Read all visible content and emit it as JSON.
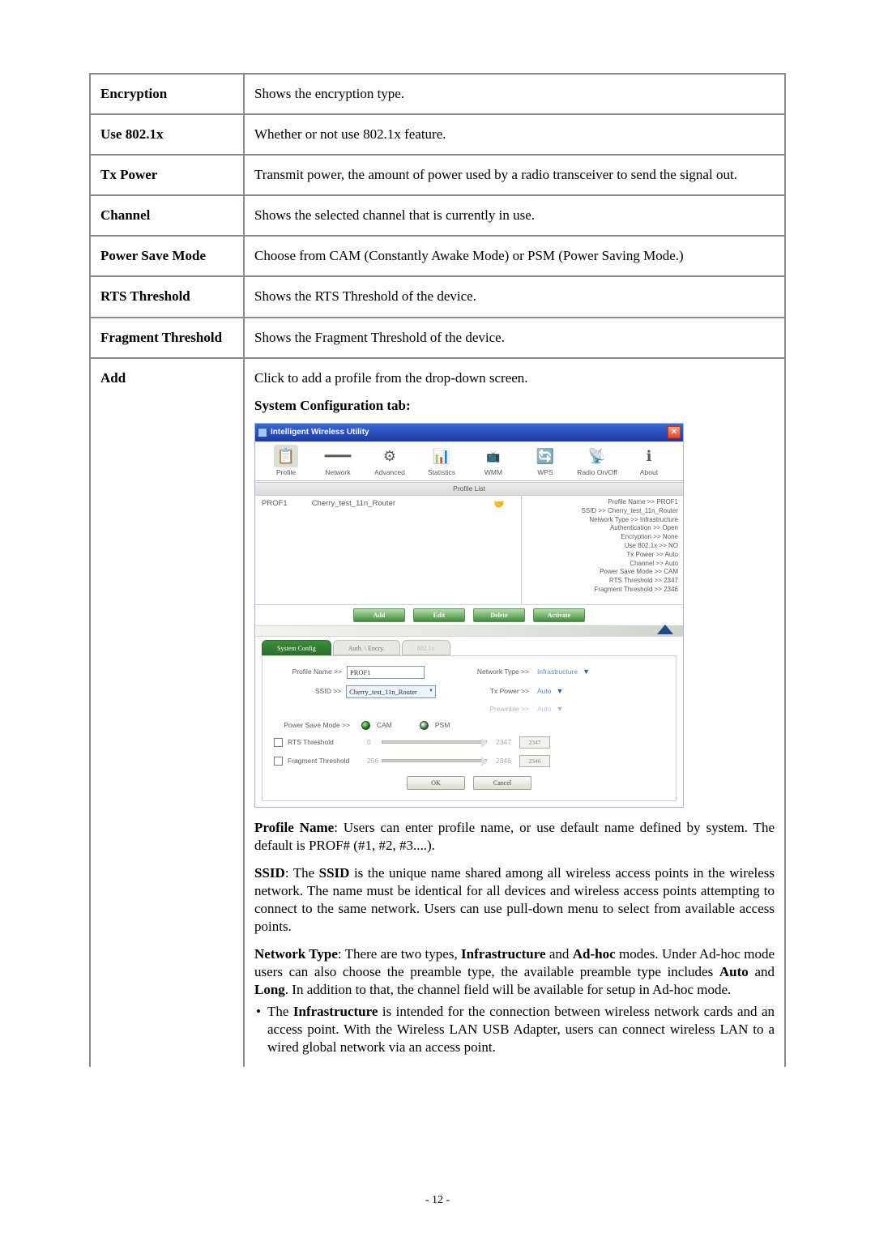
{
  "rows": [
    {
      "label": "Encryption",
      "desc": "Shows the encryption type."
    },
    {
      "label": "Use 802.1x",
      "desc": "Whether or not use 802.1x feature."
    },
    {
      "label": "Tx Power",
      "desc": "Transmit power, the amount of power used by a radio transceiver to send the signal out."
    },
    {
      "label": "Channel",
      "desc": "Shows the selected channel that is currently in use."
    },
    {
      "label": "Power Save Mode",
      "desc": "Choose from CAM (Constantly Awake Mode) or PSM (Power Saving Mode.)"
    },
    {
      "label": "RTS Threshold",
      "desc": "Shows the RTS Threshold of the device."
    },
    {
      "label": "Fragment Threshold",
      "desc": "Shows the Fragment Threshold of the device."
    }
  ],
  "add": {
    "label": "Add",
    "intro": "Click to add a profile from the drop-down screen.",
    "tab_heading": "System Configuration tab:",
    "profile_name_lead": "Profile Name",
    "profile_name_text": ": Users can enter profile name, or use default name defined by system. The default is PROF# (#1, #2, #3....).",
    "ssid_lead1": "SSID",
    "ssid_text1": ": The ",
    "ssid_lead2": "SSID",
    "ssid_text2": " is the unique name shared among all wireless access points in the wireless network. The name must be identical for all devices and wireless access points attempting to connect to the same network. Users can use pull-down menu to select from available access points.",
    "nt_lead": "Network Type",
    "nt_text1": ": There are two types, ",
    "nt_b1": "Infrastructure",
    "nt_text2": " and ",
    "nt_b2": "Ad-hoc",
    "nt_text3": " modes. Under Ad-hoc mode users can also choose the preamble type, the available preamble type includes ",
    "nt_b3": "Auto",
    "nt_text4": " and ",
    "nt_b4": "Long",
    "nt_text5": ". In addition to that, the channel field will be available for setup in Ad-hoc mode.",
    "bullet_text1": "The ",
    "bullet_b": "Infrastructure",
    "bullet_text2": " is intended for the connection between wireless network cards and an access point. With the Wireless LAN USB Adapter, users can connect wireless LAN to a wired global network via an access point."
  },
  "dialog": {
    "title": "Intelligent Wireless Utility",
    "close": "×",
    "toolbar": [
      {
        "label": "Profile",
        "glyph": "📋",
        "name": "profile"
      },
      {
        "label": "Network",
        "glyph": "🖧",
        "name": "network"
      },
      {
        "label": "Advanced",
        "glyph": "⚙",
        "name": "advanced"
      },
      {
        "label": "Statistics",
        "glyph": "📶",
        "name": "statistics"
      },
      {
        "label": "WMM",
        "glyph": "📺",
        "name": "wmm"
      },
      {
        "label": "WPS",
        "glyph": "🔄",
        "name": "wps"
      },
      {
        "label": "Radio On/Off",
        "glyph": "📡",
        "name": "radio-onoff"
      },
      {
        "label": "About",
        "glyph": "ℹ",
        "name": "about"
      }
    ],
    "profile_list_header": "Profile List",
    "list_entry": {
      "name": "PROF1",
      "ssid": "Cherry_test_11n_Router"
    },
    "details": [
      "Profile Name >> PROF1",
      "SSID >> Cherry_test_11n_Router",
      "Network Type >> Infrastructure",
      "Authentication >> Open",
      "Encryption >> None",
      "Use 802.1x >> NO",
      "Tx Power >> Auto",
      "Channel >> Auto",
      "Power Save Mode >> CAM",
      "RTS Threshold >> 2347",
      "Fragment Threshold >> 2346"
    ],
    "actions": [
      "Add",
      "Edit",
      "Delete",
      "Activate"
    ],
    "tabs": [
      "System Config",
      "Auth. \\ Encry.",
      "802.1x"
    ],
    "cfg": {
      "profile_name_lbl": "Profile Name >>",
      "profile_name_val": "PROF1",
      "ssid_lbl": "SSID >>",
      "ssid_val": "Cherry_test_11n_Router",
      "psm_lbl": "Power Save Mode >>",
      "cam": "CAM",
      "psm": "PSM",
      "nt_lbl": "Network Type >>",
      "nt_val": "Infrastructure",
      "txp_lbl": "Tx Power >>",
      "txp_val": "Auto",
      "pre_lbl": "Preamble >>",
      "pre_val": "Auto",
      "rts_lbl": "RTS Threshold",
      "rts_min": "0",
      "rts_max": "2347",
      "rts_val": "2347",
      "ft_lbl": "Fragment Threshold",
      "ft_min": "256",
      "ft_max": "2346",
      "ft_val": "2346"
    },
    "ok": "OK",
    "cancel": "Cancel"
  },
  "page_number": "- 12 -"
}
